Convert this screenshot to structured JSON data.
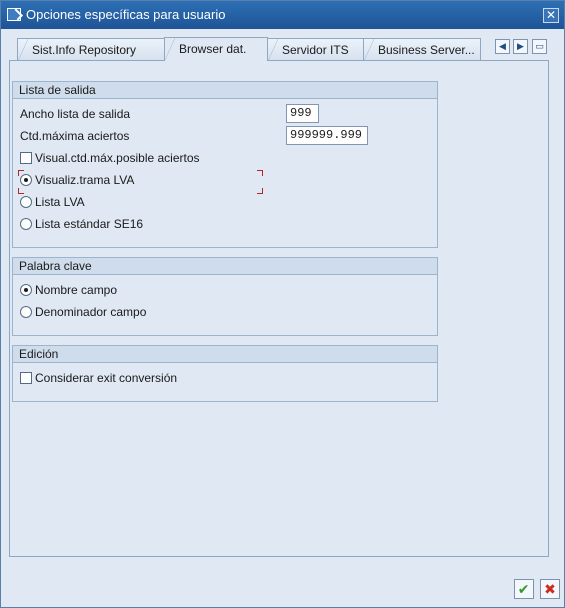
{
  "window": {
    "title": "Opciones específicas para usuario",
    "close_glyph": "✕"
  },
  "tabs": [
    {
      "label": "Sist.Info Repository",
      "active": false
    },
    {
      "label": "Browser dat.",
      "active": true
    },
    {
      "label": "Servidor ITS",
      "active": false
    },
    {
      "label": "Business Server...",
      "active": false
    }
  ],
  "tab_nav": {
    "prev": "◀",
    "next": "▶",
    "menu": "▭"
  },
  "groups": {
    "output": {
      "title": "Lista de salida",
      "width_label": "Ancho lista de salida",
      "width_value": "999",
      "maxhits_label": "Ctd.máxima aciertos",
      "maxhits_value": "999999.999",
      "checkbox_label": "Visual.ctd.máx.posible aciertos",
      "radio_options": [
        "Visualiz.trama LVA",
        "Lista LVA",
        "Lista estándar SE16"
      ],
      "selected_radio": 0
    },
    "keyword": {
      "title": "Palabra clave",
      "radio_options": [
        "Nombre campo",
        "Denominador campo"
      ],
      "selected_radio": 0
    },
    "edit": {
      "title": "Edición",
      "checkbox_label": "Considerar exit conversión"
    }
  },
  "buttons": {
    "ok_glyph": "✔",
    "cancel_glyph": "✖",
    "ok_color": "#2f9a2f",
    "cancel_color": "#cc2b1f"
  }
}
